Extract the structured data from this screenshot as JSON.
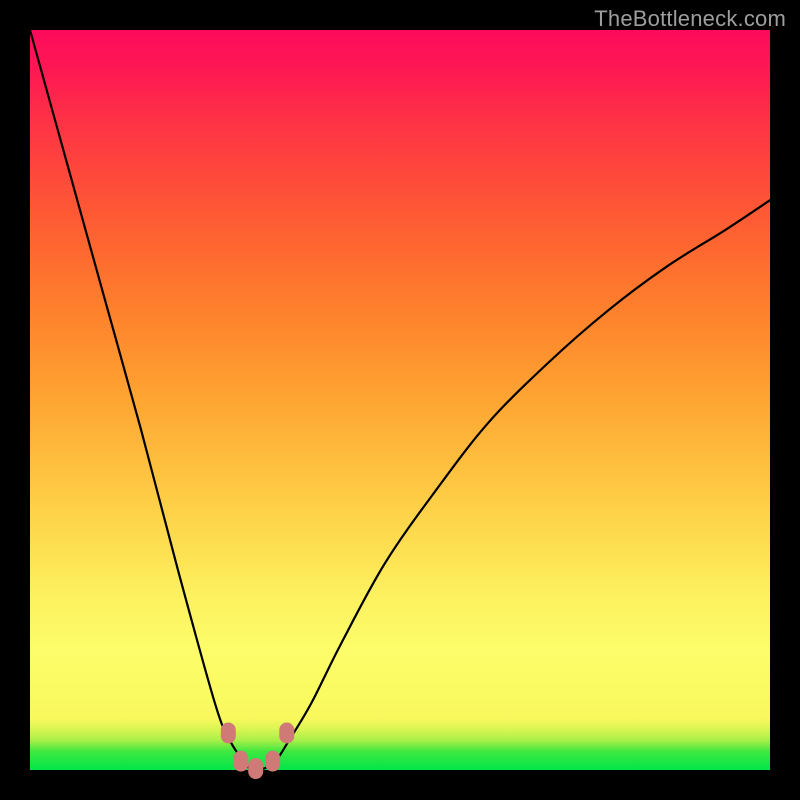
{
  "watermark": "TheBottleneck.com",
  "colors": {
    "frame_bg": "#000000",
    "curve_stroke": "#000000",
    "marker_fill": "#cf7a76",
    "gradient_top": "#fd0a5c",
    "gradient_bottom": "#00e64a"
  },
  "chart_data": {
    "type": "line",
    "title": "",
    "xlabel": "",
    "ylabel": "",
    "xlim": [
      0,
      100
    ],
    "ylim": [
      0,
      100
    ],
    "legend": false,
    "grid": false,
    "series": [
      {
        "name": "bottleneck-curve",
        "x": [
          0,
          5,
          10,
          15,
          20,
          25,
          27,
          29,
          30,
          31,
          33,
          35,
          38,
          42,
          48,
          55,
          62,
          70,
          78,
          86,
          94,
          100
        ],
        "values": [
          100,
          82,
          64,
          46,
          27,
          9,
          4,
          1,
          0,
          0,
          1,
          4,
          9,
          17,
          28,
          38,
          47,
          55,
          62,
          68,
          73,
          77
        ]
      }
    ],
    "markers": [
      {
        "x": 26.8,
        "y": 5.0
      },
      {
        "x": 28.5,
        "y": 1.2
      },
      {
        "x": 30.5,
        "y": 0.2
      },
      {
        "x": 32.8,
        "y": 1.2
      },
      {
        "x": 34.7,
        "y": 5.0
      }
    ],
    "axis_visible": false
  }
}
